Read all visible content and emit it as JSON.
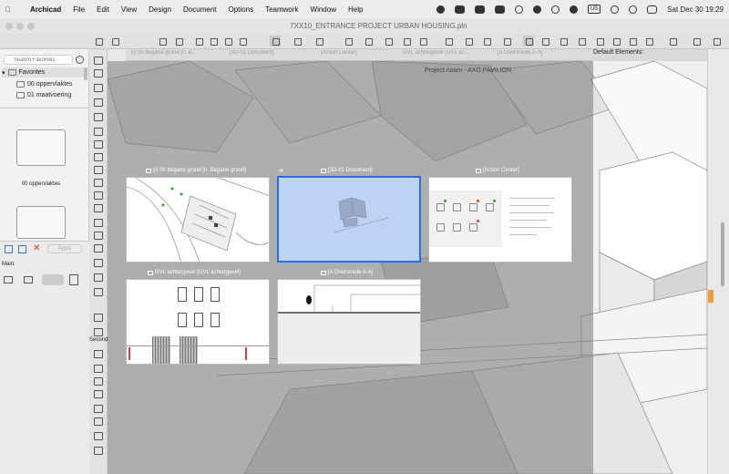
{
  "menubar": {
    "app_name": "Archicad",
    "items": [
      "File",
      "Edit",
      "View",
      "Design",
      "Document",
      "Options",
      "Teamwork",
      "Window",
      "Help"
    ],
    "keyboard_layout": "US",
    "clock": "Sat Dec 30  19:29"
  },
  "window": {
    "document_title": "7XX10_ENTRANCE PROJECT URBAN HOUSING.pln"
  },
  "tabs": [
    {
      "label": "(I) 00 begane grond [0. B..."
    },
    {
      "label": "[3D-01 Document]"
    },
    {
      "label": "[Action Center]"
    },
    {
      "label": "GVL achtergevel [GVL ac..."
    },
    {
      "label": "[A Doorsnede A-A]"
    }
  ],
  "info_panel": {
    "default_elements_label": "Default Elements:",
    "apply_label": "Apply",
    "main_label": "Main:",
    "secondary_label": "Secund"
  },
  "navigator": {
    "search_placeholder": "Search Favorites",
    "favorites_label": "Favorites",
    "items": [
      {
        "label": "00 oppervlaktes"
      },
      {
        "label": "01 maatvoering"
      }
    ],
    "preview_caption": "00 oppervlaktes"
  },
  "ghost_window": {
    "title": "Project noam - AXO PAVILION"
  },
  "tab_overview": {
    "close_glyph": "×",
    "thumbnails": [
      {
        "label": "(I) 00 begane grond [0. Begane grond]",
        "active": false
      },
      {
        "label": "[3D-01 Document]",
        "active": true
      },
      {
        "label": "[Action Center]",
        "active": false
      },
      {
        "label": "GVL achtergevel [GVL achtergevel]",
        "active": false
      },
      {
        "label": "[A Doorsnede A-A]",
        "active": false
      }
    ]
  },
  "colors": {
    "selection_border": "#2a6fdb",
    "selection_fill": "#bcd3f4",
    "overlay": "#787878"
  }
}
